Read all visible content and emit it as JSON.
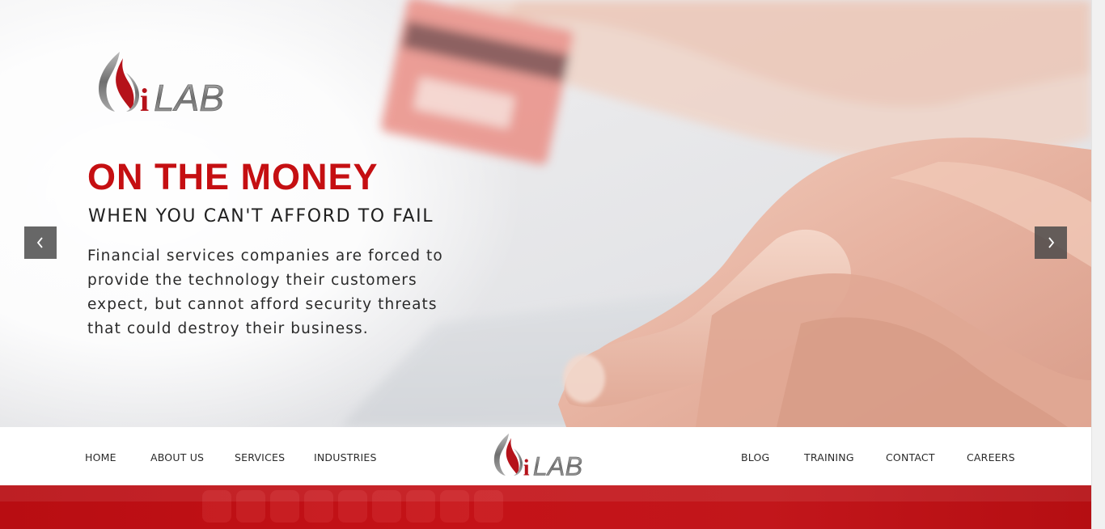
{
  "brand": {
    "logo_text": "iLAB",
    "primary_color": "#c50f12",
    "text_color": "#1f1f1f"
  },
  "hero": {
    "title": "ON THE MONEY",
    "subtitle": "WHEN YOU CAN'T AFFORD TO FAIL",
    "body": "Financial services companies are forced to provide the technology their customers expect, but cannot afford security threats that could destroy their business.",
    "prev_icon": "chevron-left-icon",
    "next_icon": "chevron-right-icon"
  },
  "nav": {
    "left": [
      "HOME",
      "ABOUT US",
      "SERVICES",
      "INDUSTRIES"
    ],
    "right": [
      "BLOG",
      "TRAINING",
      "CONTACT",
      "CAREERS"
    ]
  }
}
